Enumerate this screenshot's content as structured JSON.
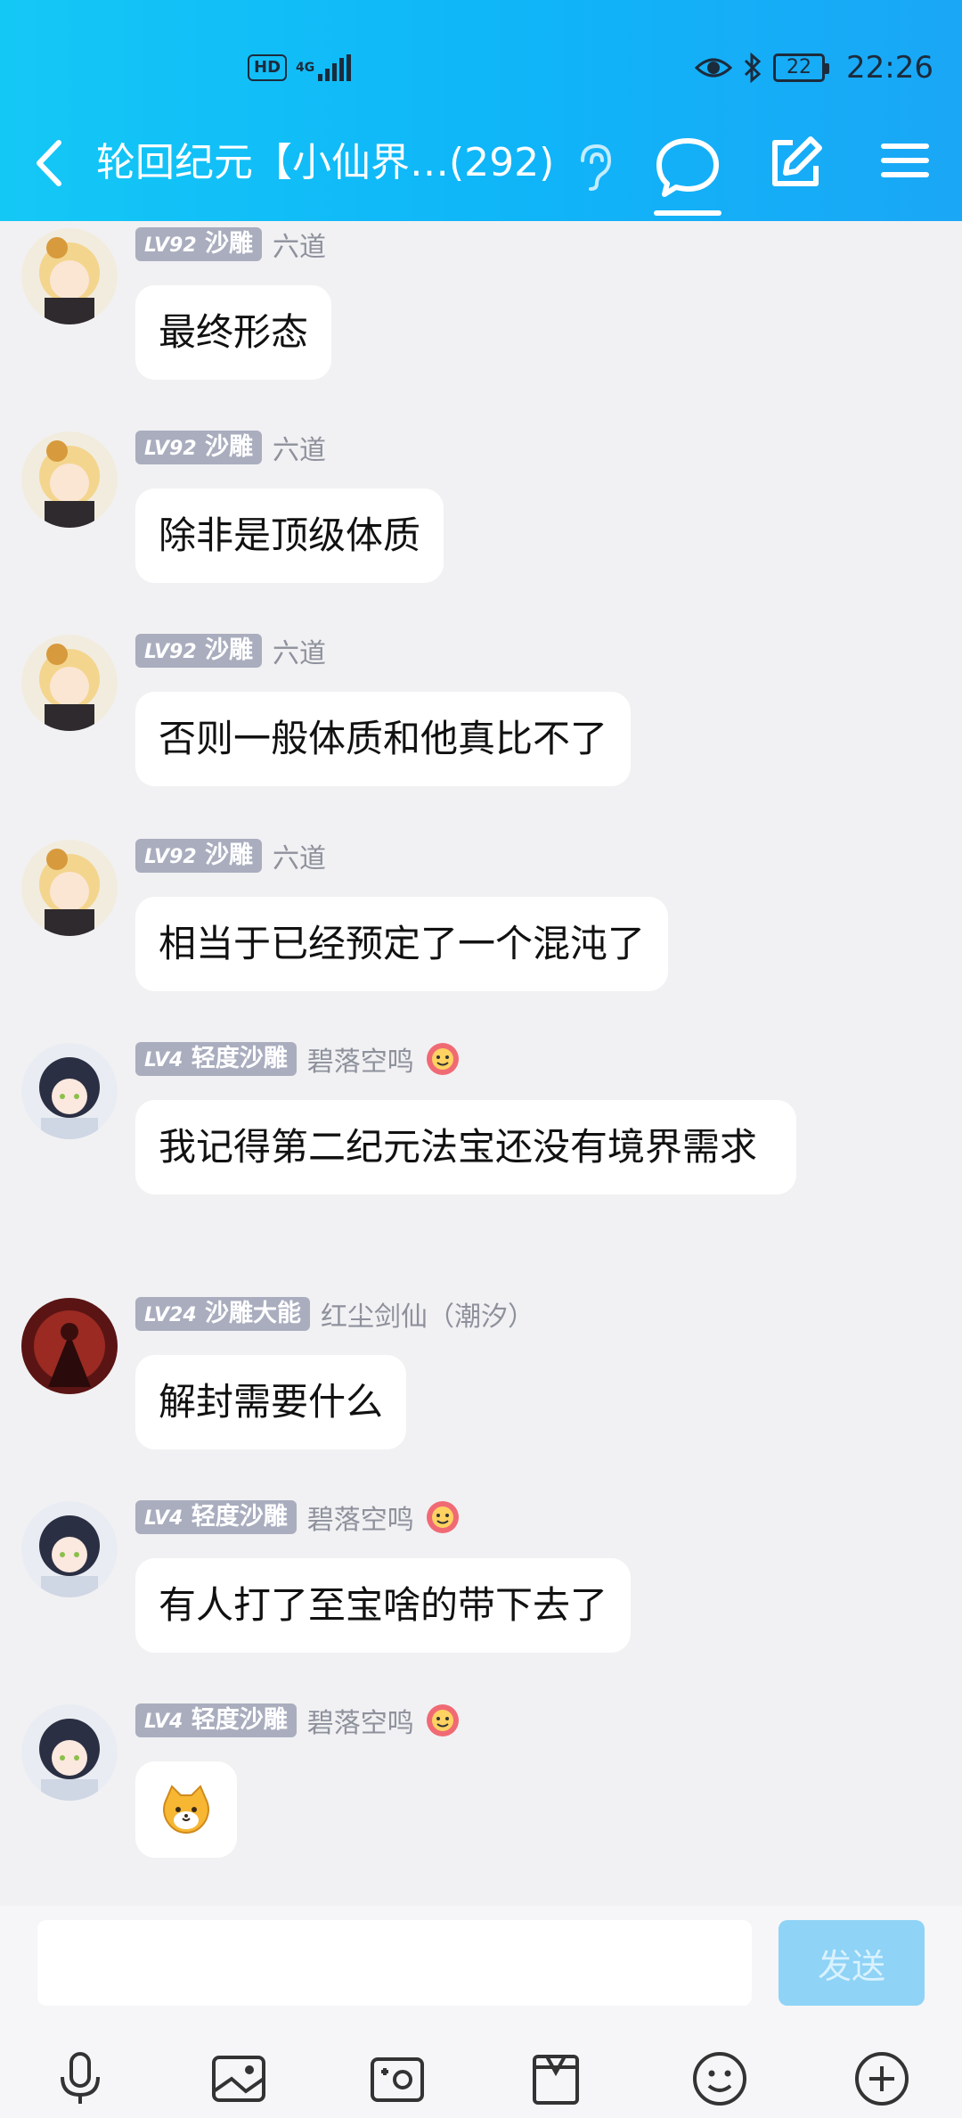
{
  "status_bar": {
    "hd": "HD",
    "network": "4G",
    "battery": "22",
    "time": "22:26"
  },
  "header": {
    "title": "轮回纪元【小仙界…(292)"
  },
  "messages": [
    {
      "level": "LV92",
      "title": "沙雕",
      "nick": "六道",
      "text": "最终形态",
      "avatar": "blonde-girl-avatar"
    },
    {
      "level": "LV92",
      "title": "沙雕",
      "nick": "六道",
      "text": "除非是顶级体质",
      "avatar": "blonde-girl-avatar"
    },
    {
      "level": "LV92",
      "title": "沙雕",
      "nick": "六道",
      "text": "否则一般体质和他真比不了",
      "avatar": "blonde-girl-avatar"
    },
    {
      "level": "LV92",
      "title": "沙雕",
      "nick": "六道",
      "text": "相当于已经预定了一个混沌了",
      "avatar": "blonde-girl-avatar"
    },
    {
      "level": "LV4",
      "title": "轻度沙雕",
      "nick": "碧落空鸣",
      "text": "我记得第二纪元法宝还没有境界需求",
      "avatar": "dark-hair-girl-avatar"
    },
    {
      "level": "LV24",
      "title": "沙雕大能",
      "nick": "红尘剑仙（潮汐）",
      "text": "解封需要什么",
      "avatar": "red-warrior-avatar"
    },
    {
      "level": "LV4",
      "title": "轻度沙雕",
      "nick": "碧落空鸣",
      "text": "有人打了至宝啥的带下去了",
      "avatar": "dark-hair-girl-avatar"
    },
    {
      "level": "LV4",
      "title": "轻度沙雕",
      "nick": "碧落空鸣",
      "text": "",
      "avatar": "dark-hair-girl-avatar",
      "sticker": "cat-face-sticker"
    }
  ],
  "input": {
    "value": "",
    "send_label": "发送"
  },
  "toolbar": [
    "mic-icon",
    "image-icon",
    "camera-icon",
    "folder-icon",
    "emoji-icon",
    "plus-icon"
  ]
}
